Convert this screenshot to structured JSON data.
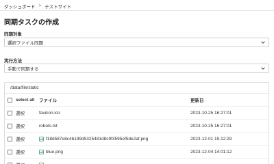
{
  "breadcrumb": {
    "items": [
      "ダッシュボード",
      "テストサイト"
    ],
    "separator": ">"
  },
  "title": "同期タスクの作成",
  "sync_target": {
    "label": "同期対象",
    "value": "選択ファイル同期"
  },
  "exec_method": {
    "label": "実行方法",
    "value": "手動で同期する"
  },
  "file_table": {
    "path": "/data/file/static",
    "headers": {
      "select_all": "select all",
      "file": "ファイル",
      "updated": "更新日"
    },
    "rows": [
      {
        "select": "選択",
        "name": "favicon.ico",
        "icon": "file-icon",
        "date": "2023-10-25 16:27:01"
      },
      {
        "select": "選択",
        "name": "robots.txt",
        "icon": "file-icon",
        "date": "2023-10-25 16:27:01"
      },
      {
        "select": "選択",
        "name": "f18d587e8c4b199d5325481d8c9f3595ef5de2af.png",
        "icon": "image-icon",
        "date": "2023-12-01 15:12:29"
      },
      {
        "select": "選択",
        "name": "blue.png",
        "icon": "image-icon",
        "date": "2023-12-04 14:01:12"
      },
      {
        "select": "選択",
        "name": "",
        "icon": "image-icon",
        "date": ""
      }
    ]
  },
  "colors": {
    "border": "#dcdcdc",
    "image_icon": "#2e8b57"
  }
}
